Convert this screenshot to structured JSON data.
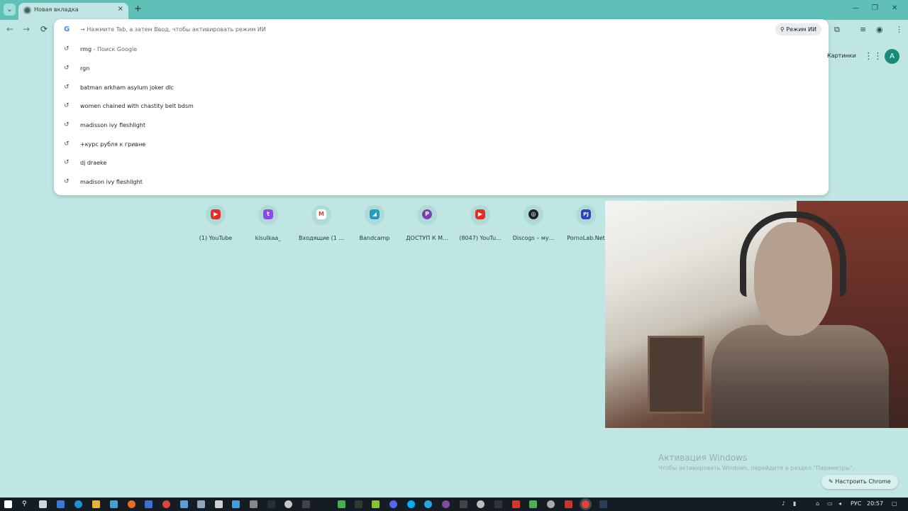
{
  "browser": {
    "tab_title": "Новая вкладка",
    "tab_close": "×",
    "new_tab": "+",
    "window_controls": [
      "—",
      "❐",
      "✕"
    ],
    "tab_search": "⌄"
  },
  "toolbar": {
    "back": "←",
    "forward": "→",
    "reload": "⟳"
  },
  "omnibox": {
    "g_icon": "G",
    "hint": "→ Нажмите Tab, а затем Ввод, чтобы активировать режим ИИ",
    "ai_mode_label": "Режим ИИ",
    "suggestions": [
      {
        "text": "rmg",
        "sub": " - Поиск Google"
      },
      {
        "text": "rgn",
        "sub": ""
      },
      {
        "text": "batman arkham asylum joker dlc",
        "sub": ""
      },
      {
        "text": "women chained with chastity belt bdsm",
        "sub": ""
      },
      {
        "text": "madisson ivy fleshlight",
        "sub": ""
      },
      {
        "text": "+курс рубля к гривне",
        "sub": ""
      },
      {
        "text": "dj draeke",
        "sub": ""
      },
      {
        "text": "madison ivy fleshlight",
        "sub": ""
      }
    ]
  },
  "google": {
    "images_link": "Картинки",
    "apps_icon": "⋮⋮⋮",
    "avatar_letter": "A"
  },
  "shortcuts": [
    {
      "name": "(1) YouTube",
      "color": "#e52d27",
      "glyph": "▶"
    },
    {
      "name": "kisulkaa_",
      "color": "#8a49e6",
      "glyph": "t"
    },
    {
      "name": "Входящие (1 ...",
      "color": "#db4437",
      "glyph": "M"
    },
    {
      "name": "Bandcamp",
      "color": "#1da0c3",
      "glyph": "◢"
    },
    {
      "name": "ДОСТУП К М...",
      "color": "#7a3fb0",
      "glyph": "P"
    },
    {
      "name": "(8047) YouTu...",
      "color": "#e52d27",
      "glyph": "▶"
    },
    {
      "name": "Discogs – му...",
      "color": "#222222",
      "glyph": "◎"
    },
    {
      "name": "PornoLab.Net",
      "color": "#2b44c4",
      "glyph": "PJ"
    }
  ],
  "activation": {
    "title": "Активация Windows",
    "subtitle": "Чтобы активировать Windows, перейдите в раздел \"Параметры\"."
  },
  "customize_label": "Настроить Chrome",
  "taskbar": {
    "language": "РУС",
    "time": "20:57"
  }
}
